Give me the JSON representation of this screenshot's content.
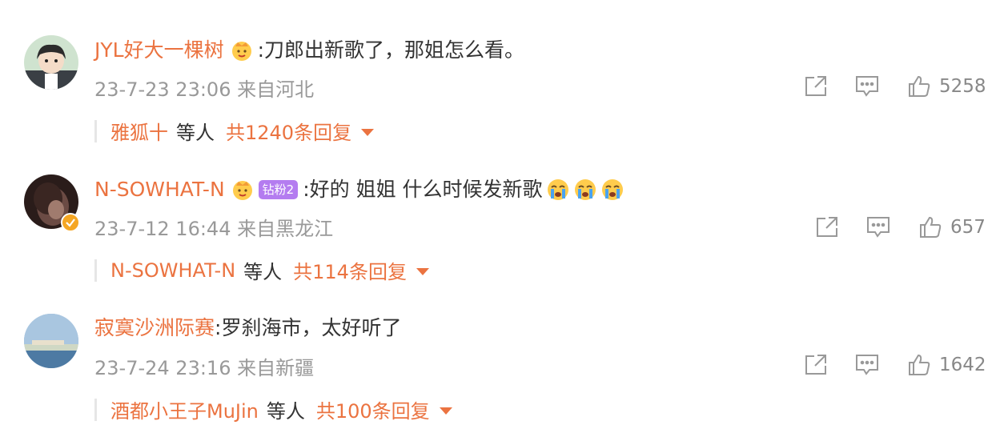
{
  "comments": [
    {
      "username": "JYL好大一棵树",
      "text": ":刀郎出新歌了，那姐怎么看。",
      "meta": "23-7-23 23:06 来自河北",
      "likes": "5258",
      "reply_names": "雅狐十",
      "reply_mid": "等人",
      "reply_total": "共1240条回复"
    },
    {
      "username": "N-SOWHAT-N",
      "level_badge": "钻粉2",
      "text": ":好的 姐姐 什么时候发新歌",
      "meta": "23-7-12 16:44 来自黑龙江",
      "likes": "657",
      "reply_names": "N-SOWHAT-N",
      "reply_mid": "等人",
      "reply_total": "共114条回复"
    },
    {
      "username": "寂寞沙洲际赛",
      "text": ":罗刹海市，太好听了",
      "meta": "23-7-24 23:16 来自新疆",
      "likes": "1642",
      "reply_names": "酒都小王子MuJin",
      "reply_mid": "等人",
      "reply_total": "共100条回复"
    }
  ],
  "icons": {
    "share": "share-icon",
    "comment": "comment-icon",
    "like": "thumbs-up-icon",
    "crown": "crown-icon",
    "emoji": "crying-face-emoji",
    "verified": "verified-badge"
  },
  "colors": {
    "accent": "#eb7340",
    "meta": "#999999",
    "text": "#333333"
  }
}
